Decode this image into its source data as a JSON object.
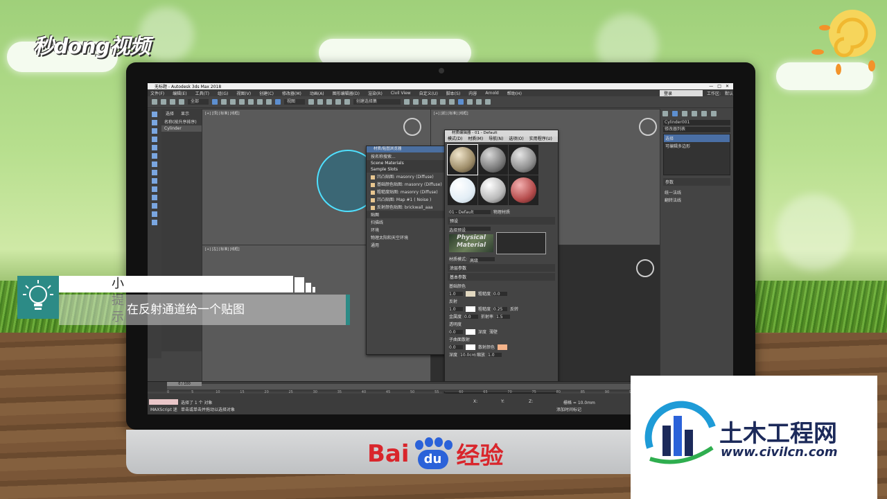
{
  "brand": {
    "logo_text": "秒dong视频"
  },
  "window": {
    "title": "无标题 - Autodesk 3ds Max 2018"
  },
  "menubar": {
    "items": [
      "文件(F)",
      "编辑(E)",
      "工具(T)",
      "组(G)",
      "视图(V)",
      "创建(C)",
      "修改器(M)",
      "动画(A)",
      "图形编辑器(D)",
      "渲染(R)",
      "Civil View",
      "自定义(U)",
      "脚本(S)",
      "内容",
      "Arnold",
      "帮助(H)"
    ],
    "login": "登录",
    "workspace_label": "工作区:",
    "workspace_value": "默认"
  },
  "toolbar": {
    "filter": "全部",
    "view": "视图",
    "selection_set": "创建选择集"
  },
  "scene_explorer": {
    "tab_select": "选择",
    "tab_display": "显示",
    "header": "名称(按升序排序)",
    "object": "Cylinder"
  },
  "viewports": {
    "top_left": "[+] [顶] [标准] [线框]",
    "top_right": "[+] [前] [标准] [线框]",
    "bottom_left": "[+] [左] [标准] [线框]"
  },
  "material_browser": {
    "title": "材质/贴图浏览器",
    "search": "按名称搜索...",
    "sections": [
      "Scene Materials",
      "Sample Slots"
    ],
    "rows": [
      "凹凸贴图: masonry (Diffuse)",
      "基础颜色贴图: masonry (Diffuse)",
      "粗糙度贴图: masonry (Diffuse)",
      "凹凸贴图: Map #1 ( Noise )",
      "反射颜色贴图: brickwall_aaa"
    ],
    "maps": "贴图",
    "maps_items": [
      "扫描线",
      "环境",
      "物理太阳和天空环境",
      "通用"
    ]
  },
  "material_editor": {
    "title": "材质编辑器 - 01 - Default",
    "menu": [
      "模式(D)",
      "材质(M)",
      "导航(N)",
      "选项(O)",
      "实用程序(U)"
    ],
    "material_name": "01 - Default",
    "material_type": "物理材质",
    "preset_section": "预设",
    "preset_value": "选择预设",
    "phys_label": "Physical Material",
    "mode_label": "材质模式:",
    "mode_value": "高级",
    "coating": "涂层参数",
    "basic": "基本参数",
    "base_color": "基础颜色",
    "reflection": "反射",
    "transparency": "透明度",
    "sss": "子曲面散射",
    "roughness": "粗糙度",
    "metalness": "金属度",
    "ior": "折射率",
    "inverse": "反转",
    "depth": "深度",
    "thin": "薄壁",
    "scatter_color": "散射颜色",
    "scale": "缩放",
    "v_1": "1.0",
    "v_025": "0.25",
    "v_15": "1.5",
    "v_00": "0.0",
    "v_10cm": "10.0cm"
  },
  "command_panel": {
    "object_name": "Cylinder001",
    "modifier_list": "修改器列表",
    "stack": [
      "选择",
      "可编辑多边形"
    ],
    "params": "参数",
    "param_items": [
      "统一法线",
      "翻转法线"
    ]
  },
  "timeline": {
    "frame": "0 / 100",
    "ticks": [
      "0",
      "5",
      "10",
      "15",
      "20",
      "25",
      "30",
      "35",
      "40",
      "45",
      "50",
      "55",
      "60",
      "65",
      "70",
      "75",
      "80",
      "85",
      "90",
      "95",
      "100"
    ]
  },
  "status": {
    "selected": "选择了 1 个 对象",
    "hint": "单击或单击并拖动以选择对象",
    "maxscript": "MAXScript 迷",
    "grid": "栅格 = 10.0mm",
    "add_time_tag": "添加时间标记",
    "x_label": "X:",
    "y_label": "Y:",
    "z_label": "Z:"
  },
  "tip": {
    "title": "小提示",
    "text": "在反射通道给一个贴图"
  },
  "monitor_brand": {
    "bai": "Bai",
    "du": "du",
    "jingyan": "经验"
  },
  "watermark": {
    "name": "土木工程网",
    "url": "www.civilcn.com"
  },
  "colors": {
    "accent_teal": "#2c8b86",
    "baidu_red": "#d9262c",
    "baidu_blue": "#2b62d9",
    "cyl_cyan": "#4fe0ff"
  }
}
